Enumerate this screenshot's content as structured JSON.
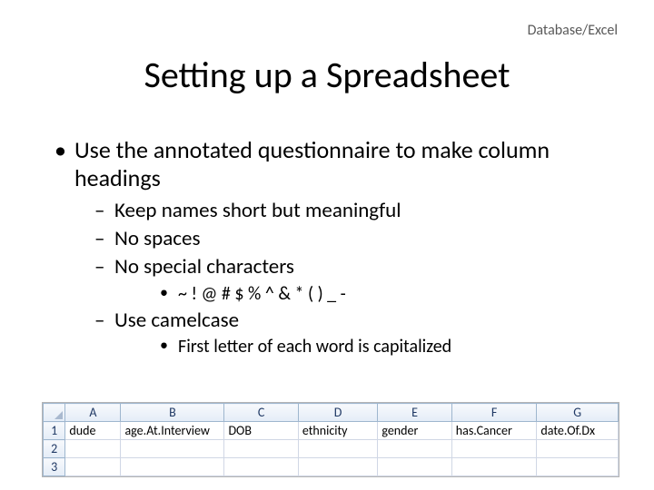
{
  "tag": "Database/Excel",
  "title": "Setting up a Spreadsheet",
  "bullets": {
    "main": "Use the annotated questionnaire to make column headings",
    "sub1": "Keep names short but meaningful",
    "sub2": "No spaces",
    "sub3": "No special characters",
    "sub3a": "~ ! @ # $ % ^ & * ( ) _ -",
    "sub4": "Use camelcase",
    "sub4a": "First letter of each word is capitalized"
  },
  "sheet": {
    "col_letters": [
      "A",
      "B",
      "C",
      "D",
      "E",
      "F",
      "G"
    ],
    "row_numbers": [
      "1",
      "2",
      "3"
    ],
    "headers": [
      "dude",
      "age.At.Interview",
      "DOB",
      "ethnicity",
      "gender",
      "has.Cancer",
      "date.Of.Dx"
    ]
  }
}
